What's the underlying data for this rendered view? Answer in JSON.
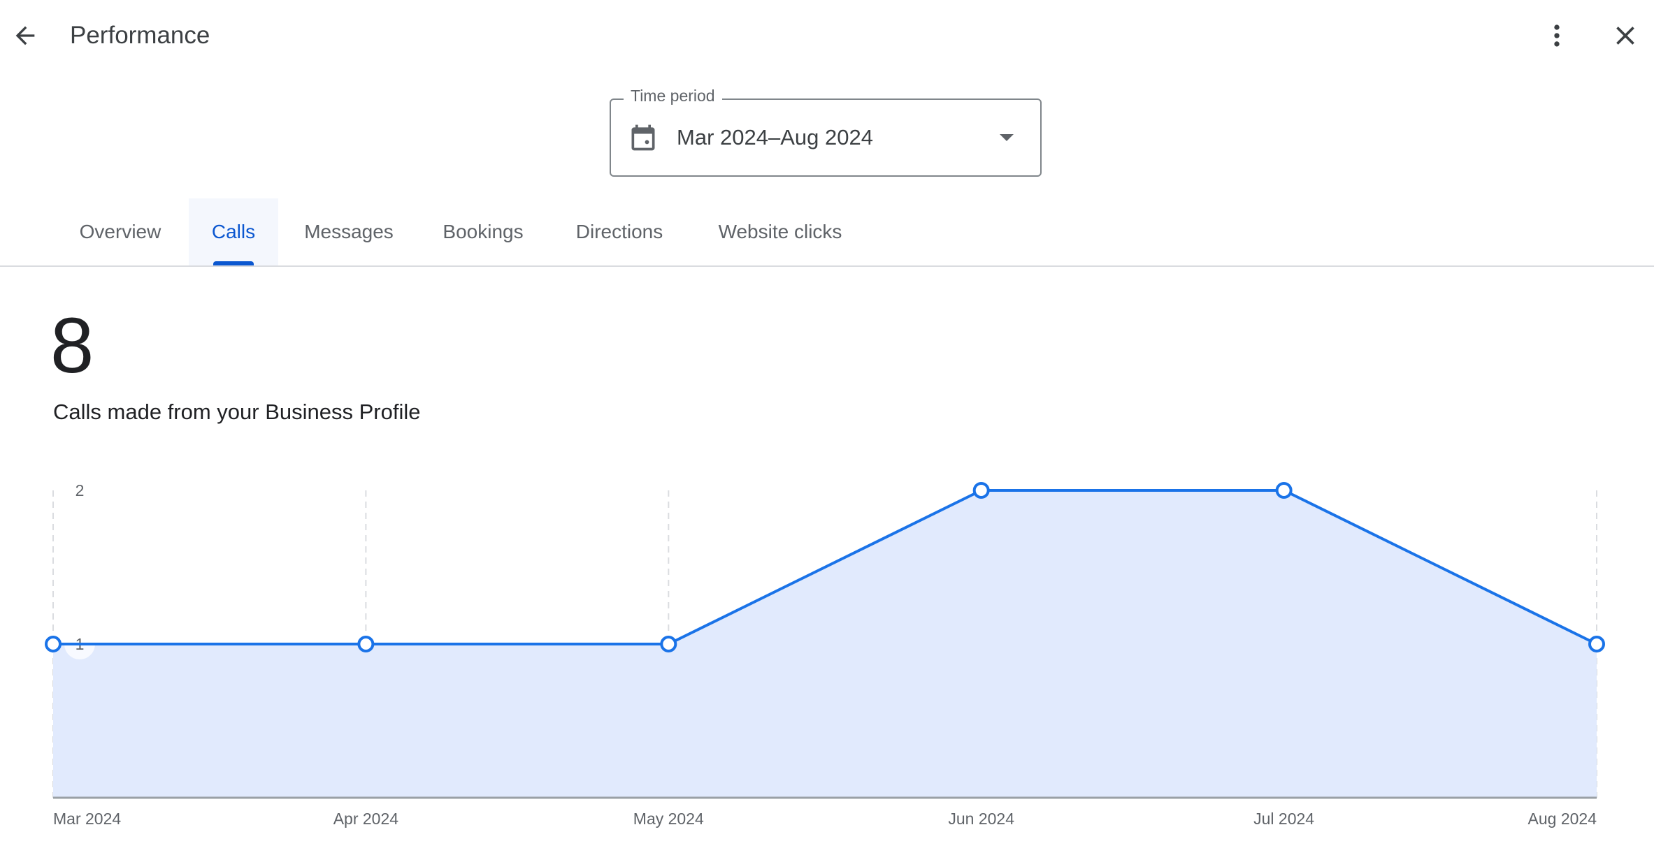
{
  "header": {
    "title": "Performance",
    "back_icon": "arrow-back-icon",
    "more_icon": "more-vert-icon",
    "close_icon": "close-icon"
  },
  "time_period": {
    "label": "Time period",
    "value": "Mar 2024–Aug 2024",
    "icon": "calendar-icon",
    "dropdown_icon": "arrow-drop-down-icon"
  },
  "tabs": [
    {
      "label": "Overview",
      "active": false
    },
    {
      "label": "Calls",
      "active": true
    },
    {
      "label": "Messages",
      "active": false
    },
    {
      "label": "Bookings",
      "active": false
    },
    {
      "label": "Directions",
      "active": false
    },
    {
      "label": "Website clicks",
      "active": false
    }
  ],
  "summary": {
    "total": "8",
    "description": "Calls made from your Business Profile"
  },
  "colors": {
    "accent": "#1a73e8",
    "area_fill": "#e1eafd",
    "active_tab": "#0b57d0",
    "active_tab_bg": "#f4f7fd"
  },
  "chart_data": {
    "type": "area",
    "title": "",
    "xlabel": "",
    "ylabel": "",
    "categories": [
      "Mar 2024",
      "Apr 2024",
      "May 2024",
      "Jun 2024",
      "Jul 2024",
      "Aug 2024"
    ],
    "x_dates": [
      "2024-03-01",
      "2024-04-01",
      "2024-05-01",
      "2024-06-01",
      "2024-07-01",
      "2024-08-01"
    ],
    "series": [
      {
        "name": "Calls",
        "values": [
          1,
          1,
          1,
          2,
          2,
          1
        ]
      }
    ],
    "y_ticks": [
      1,
      2
    ],
    "ylim": [
      0,
      2
    ],
    "grid": "vertical dashed",
    "legend": "none"
  }
}
